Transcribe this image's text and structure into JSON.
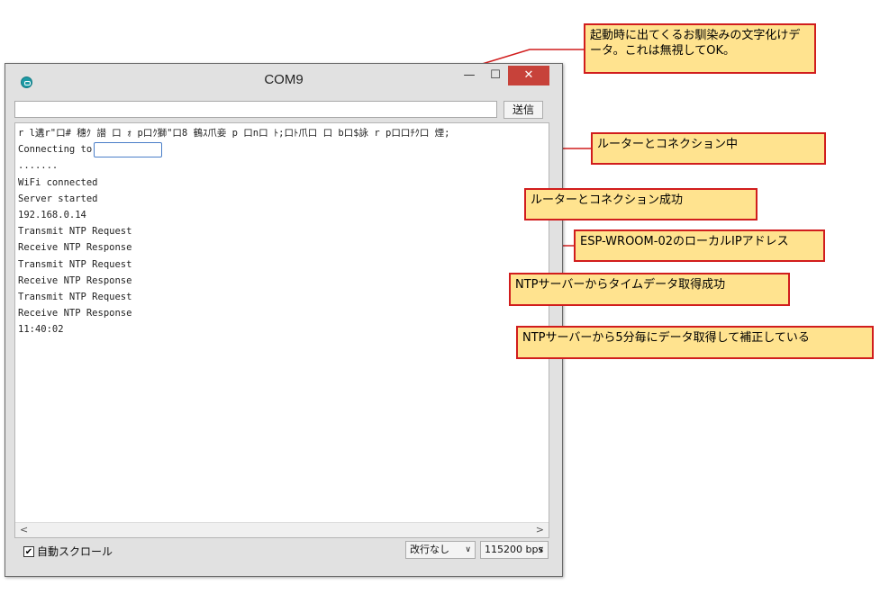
{
  "window": {
    "title": "COM9",
    "controls": {
      "minimize": "—",
      "maximize": "☐",
      "close": "✕"
    },
    "send_button": "送信",
    "send_value": "",
    "autoscroll_label": "自動スクロール",
    "autoscroll_checked": "✔",
    "line_ending": "改行なし",
    "baud": "115200 bps",
    "icons": {
      "app": "arduino-icon",
      "dropdown": "chevron-down-icon"
    }
  },
  "console": {
    "lines": [
      "r  l遘r\"口# 穗ｸ 譛  口   ｫ  p口ｸ獅\"口8 鶴ｽ爪妾 p    口n口 ﾄ;口ﾄ爪口   口 b口$詠  r  p口口ﾁｸ口   煙;",
      "Connecting to",
      ".......",
      "WiFi connected",
      "Server started",
      "192.168.0.14",
      "Transmit NTP Request",
      "Receive NTP Response",
      "Transmit NTP Request",
      "Receive NTP Response",
      "Transmit NTP Request",
      "Receive NTP Response",
      "11:40:02"
    ]
  },
  "callouts": [
    {
      "text": "起動時に出てくるお馴染みの文字化けデータ。これは無視してOK。"
    },
    {
      "text": "ルーターとコネクション中"
    },
    {
      "text": "ルーターとコネクション成功"
    },
    {
      "text": "ESP-WROOM-02のローカルIPアドレス"
    },
    {
      "text": "NTPサーバーからタイムデータ取得成功"
    },
    {
      "text": "NTPサーバーから5分毎にデータ取得して補正している"
    }
  ],
  "colors": {
    "callout_fill": "#ffe38f",
    "callout_border": "#d11d1d",
    "close_button": "#c7423a"
  }
}
